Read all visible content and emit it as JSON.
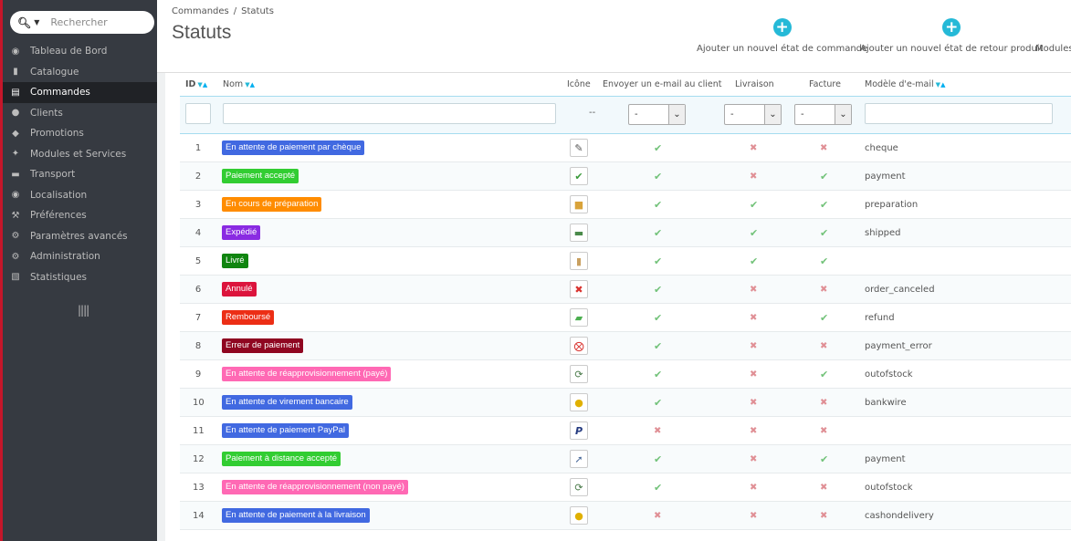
{
  "search": {
    "placeholder": "Rechercher"
  },
  "sidebar": {
    "items": [
      {
        "label": "Tableau de Bord",
        "icon": "dashboard-icon"
      },
      {
        "label": "Catalogue",
        "icon": "book-icon"
      },
      {
        "label": "Commandes",
        "icon": "credit-card-icon",
        "active": true
      },
      {
        "label": "Clients",
        "icon": "users-icon"
      },
      {
        "label": "Promotions",
        "icon": "tags-icon"
      },
      {
        "label": "Modules et Services",
        "icon": "puzzle-icon"
      },
      {
        "label": "Transport",
        "icon": "truck-icon"
      },
      {
        "label": "Localisation",
        "icon": "globe-icon"
      },
      {
        "label": "Préférences",
        "icon": "wrench-icon"
      },
      {
        "label": "Paramètres avancés",
        "icon": "cogs-icon"
      },
      {
        "label": "Administration",
        "icon": "cog-icon"
      },
      {
        "label": "Statistiques",
        "icon": "bar-chart-icon"
      }
    ]
  },
  "breadcrumb": {
    "parent": "Commandes",
    "separator": "/",
    "current": "Statuts"
  },
  "page": {
    "title": "Statuts"
  },
  "toolbar": {
    "add_order_state": "Ajouter un nouvel état de commande",
    "add_return_state": "Ajouter un nouvel état de retour produit",
    "modules": "Modules"
  },
  "table": {
    "headers": {
      "id": "ID",
      "name": "Nom",
      "icon": "Icône",
      "send_email": "Envoyer un e-mail au client",
      "delivery": "Livraison",
      "invoice": "Facture",
      "template": "Modèle d'e-mail"
    },
    "filters": {
      "icon_placeholder": "--",
      "select_value": "-"
    },
    "rows": [
      {
        "id": "1",
        "name": "En attente de paiement par chèque",
        "color": "#4169e1",
        "icon": "cheque-icon",
        "email": true,
        "delivery": false,
        "invoice": false,
        "template": "cheque"
      },
      {
        "id": "2",
        "name": "Paiement accepté",
        "color": "#32cd32",
        "icon": "check-icon",
        "email": true,
        "delivery": false,
        "invoice": true,
        "template": "payment"
      },
      {
        "id": "3",
        "name": "En cours de préparation",
        "color": "#ff8c00",
        "icon": "package-icon",
        "email": true,
        "delivery": true,
        "invoice": true,
        "template": "preparation"
      },
      {
        "id": "4",
        "name": "Expédié",
        "color": "#8a2be2",
        "icon": "truck-icon",
        "email": true,
        "delivery": true,
        "invoice": true,
        "template": "shipped"
      },
      {
        "id": "5",
        "name": "Livré",
        "color": "#108510",
        "icon": "box-icon",
        "email": true,
        "delivery": true,
        "invoice": true,
        "template": ""
      },
      {
        "id": "6",
        "name": "Annulé",
        "color": "#dc143c",
        "icon": "cross-icon",
        "email": true,
        "delivery": false,
        "invoice": false,
        "template": "order_canceled"
      },
      {
        "id": "7",
        "name": "Remboursé",
        "color": "#ec2e15",
        "icon": "money-icon",
        "email": true,
        "delivery": false,
        "invoice": true,
        "template": "refund"
      },
      {
        "id": "8",
        "name": "Erreur de paiement",
        "color": "#8f0621",
        "icon": "error-icon",
        "email": true,
        "delivery": false,
        "invoice": false,
        "template": "payment_error"
      },
      {
        "id": "9",
        "name": "En attente de réapprovisionnement (payé)",
        "color": "#ff69b4",
        "icon": "restock-icon",
        "email": true,
        "delivery": false,
        "invoice": true,
        "template": "outofstock"
      },
      {
        "id": "10",
        "name": "En attente de virement bancaire",
        "color": "#4169e1",
        "icon": "coins-icon",
        "email": true,
        "delivery": false,
        "invoice": false,
        "template": "bankwire"
      },
      {
        "id": "11",
        "name": "En attente de paiement PayPal",
        "color": "#4169e1",
        "icon": "paypal-icon",
        "email": false,
        "delivery": false,
        "invoice": false,
        "template": ""
      },
      {
        "id": "12",
        "name": "Paiement à distance accepté",
        "color": "#32cd32",
        "icon": "remote-payment-icon",
        "email": true,
        "delivery": false,
        "invoice": true,
        "template": "payment"
      },
      {
        "id": "13",
        "name": "En attente de réapprovisionnement (non payé)",
        "color": "#ff69b4",
        "icon": "restock-icon",
        "email": true,
        "delivery": false,
        "invoice": false,
        "template": "outofstock"
      },
      {
        "id": "14",
        "name": "En attente de paiement à la livraison",
        "color": "#4169e1",
        "icon": "coins-icon",
        "email": false,
        "delivery": false,
        "invoice": false,
        "template": "cashondelivery"
      }
    ]
  }
}
